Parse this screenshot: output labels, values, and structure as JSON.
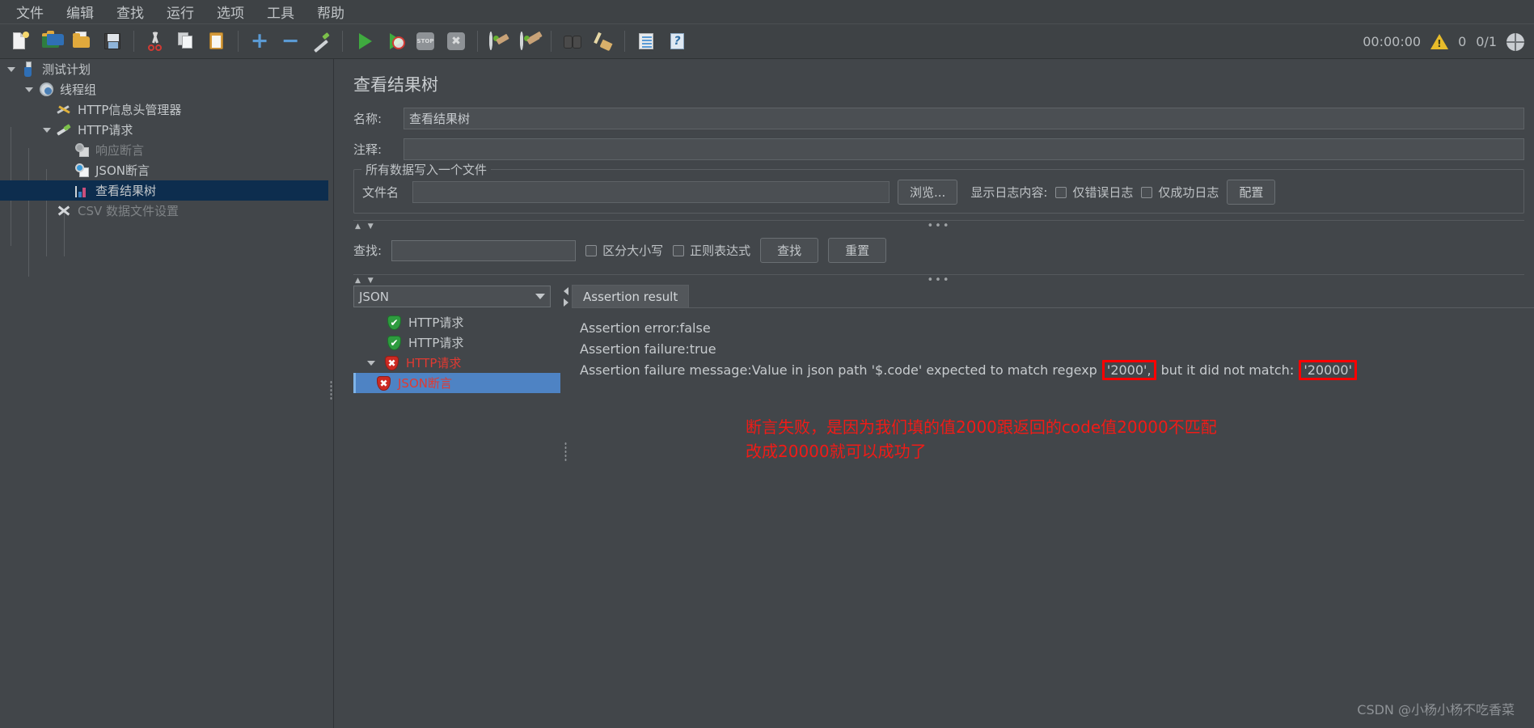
{
  "menu": {
    "items": [
      {
        "label": "文件",
        "name": "menu-file"
      },
      {
        "label": "编辑",
        "name": "menu-edit"
      },
      {
        "label": "查找",
        "name": "menu-search"
      },
      {
        "label": "运行",
        "name": "menu-run"
      },
      {
        "label": "选项",
        "name": "menu-options"
      },
      {
        "label": "工具",
        "name": "menu-tools"
      },
      {
        "label": "帮助",
        "name": "menu-help"
      }
    ]
  },
  "toolbar": {
    "icons": [
      "new-file-icon",
      "open-template-icon",
      "open-folder-icon",
      "save-icon",
      "cut-icon",
      "copy-icon",
      "paste-icon",
      "expand-all-icon",
      "collapse-all-icon",
      "toggle-icon",
      "start-icon",
      "start-no-pauses-icon",
      "stop-icon",
      "shutdown-icon",
      "clear-icon",
      "clear-all-icon",
      "search-icon",
      "search-reset-icon",
      "function-helper-icon",
      "help-icon"
    ],
    "timer": "00:00:00",
    "warning_count": "0",
    "thread_count": "0/1",
    "warning_icon": "warning-triangle-icon",
    "remote_icon": "globe-icon"
  },
  "tree": {
    "items": [
      {
        "label": "测试计划",
        "icon": "flask-icon",
        "depth": 0,
        "expander": "chevron-down-icon",
        "state": "normal"
      },
      {
        "label": "线程组",
        "icon": "gear-icon",
        "depth": 1,
        "expander": "chevron-down-icon",
        "state": "normal"
      },
      {
        "label": "HTTP信息头管理器",
        "icon": "tools-icon",
        "depth": 2,
        "expander": "",
        "state": "normal"
      },
      {
        "label": "HTTP请求",
        "icon": "pen-icon",
        "depth": 2,
        "expander": "chevron-down-icon",
        "state": "normal"
      },
      {
        "label": "响应断言",
        "icon": "magnifier-gray-icon",
        "depth": 3,
        "expander": "",
        "state": "disabled"
      },
      {
        "label": "JSON断言",
        "icon": "magnifier-icon",
        "depth": 3,
        "expander": "",
        "state": "normal"
      },
      {
        "label": "查看结果树",
        "icon": "chart-icon",
        "depth": 3,
        "expander": "",
        "state": "selected"
      },
      {
        "label": "CSV 数据文件设置",
        "icon": "csv-icon",
        "depth": 2,
        "expander": "",
        "state": "disabled"
      }
    ]
  },
  "panel": {
    "title": "查看结果树",
    "name_label": "名称:",
    "name_value": "查看结果树",
    "comment_label": "注释:",
    "comment_value": "",
    "group_legend": "所有数据写入一个文件",
    "filename_label": "文件名",
    "filename_value": "",
    "browse_button": "浏览...",
    "log_display_label": "显示日志内容:",
    "errors_only_label": "仅错误日志",
    "success_only_label": "仅成功日志",
    "configure_button": "配置",
    "search_label": "查找:",
    "search_value": "",
    "case_sensitive_label": "区分大小写",
    "regex_label": "正则表达式",
    "find_button": "查找",
    "reset_button": "重置",
    "splitter_dots": "•••",
    "splitter_arrows": "▲ ▼"
  },
  "results": {
    "renderer_selected": "JSON",
    "items": [
      {
        "label": "HTTP请求",
        "status": "pass",
        "icon": "shield-pass-icon",
        "indent": 1,
        "expander": "",
        "selected": false
      },
      {
        "label": "HTTP请求",
        "status": "pass",
        "icon": "shield-pass-icon",
        "indent": 1,
        "expander": "",
        "selected": false
      },
      {
        "label": "HTTP请求",
        "status": "fail",
        "icon": "shield-fail-icon",
        "indent": 1,
        "expander": "chevron-down-icon",
        "selected": false
      },
      {
        "label": "JSON断言",
        "status": "fail",
        "icon": "shield-fail-icon",
        "indent": 2,
        "expander": "",
        "selected": true
      }
    ]
  },
  "detail": {
    "tab_label": "Assertion result",
    "line1": "Assertion error:false",
    "line2": "Assertion failure:true",
    "line3_a": "Assertion failure message:Value in json path '$.code' expected to match regexp",
    "line3_hl1": "'2000',",
    "line3_b": "but it did not match:",
    "line3_hl2": "'20000'"
  },
  "annotation": {
    "line1": "断言失败，是因为我们填的值2000跟返回的code值20000不匹配",
    "line2": "改成20000就可以成功了",
    "color": "#f01b17"
  },
  "watermark": "CSDN @小杨小杨不吃香菜",
  "colors": {
    "bg": "#42464a",
    "toolbar_bg": "#3e4245",
    "selection_blue": "#0d2d4e",
    "result_selection": "#4e83c4",
    "fail_red": "#e03a32",
    "annotation_red": "#f01b17"
  }
}
